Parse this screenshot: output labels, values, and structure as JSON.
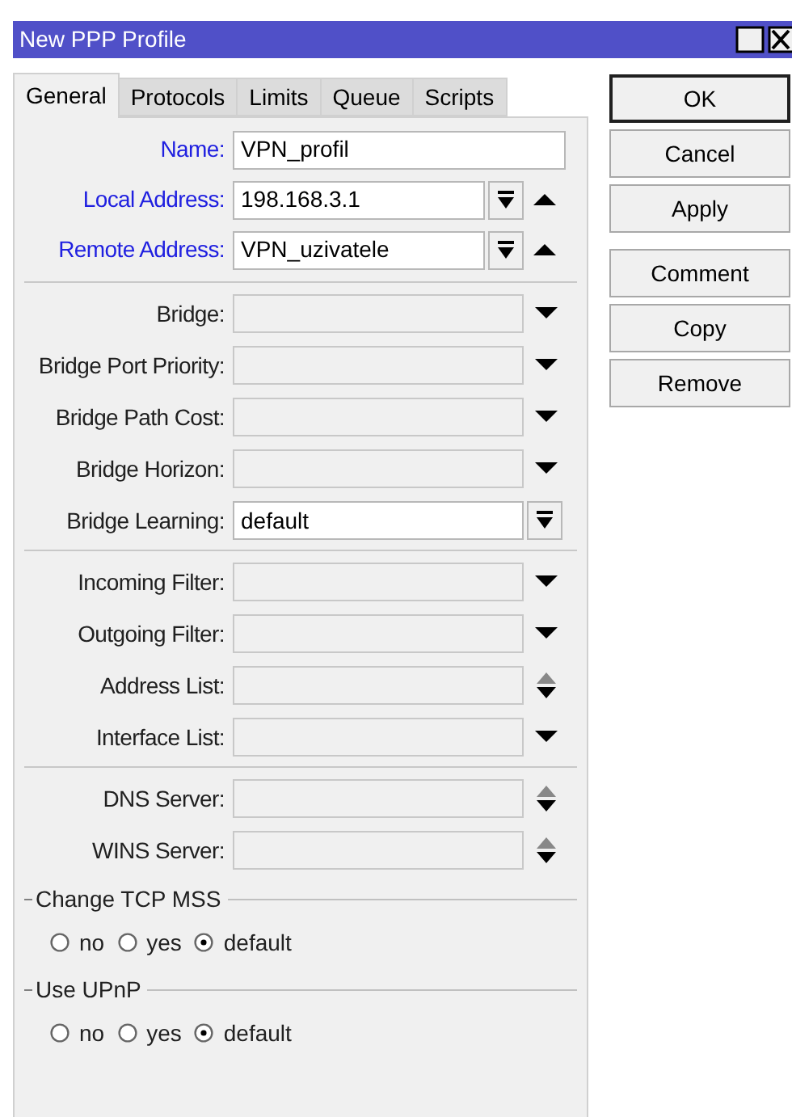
{
  "window": {
    "title": "New PPP Profile"
  },
  "tabs": [
    {
      "label": "General",
      "selected": true
    },
    {
      "label": "Protocols",
      "selected": false
    },
    {
      "label": "Limits",
      "selected": false
    },
    {
      "label": "Queue",
      "selected": false
    },
    {
      "label": "Scripts",
      "selected": false
    }
  ],
  "sections": [
    [
      {
        "label": "Name:",
        "kind": "text",
        "value": "VPN_profil",
        "emphasized": true,
        "disabled": false
      },
      {
        "label": "Local Address:",
        "kind": "combo",
        "value": "198.168.3.1",
        "emphasized": true,
        "disabled": false
      },
      {
        "label": "Remote Address:",
        "kind": "combo",
        "value": "VPN_uzivatele",
        "emphasized": true,
        "disabled": false
      }
    ],
    [
      {
        "label": "Bridge:",
        "kind": "dropdown",
        "emphasized": false,
        "disabled": true
      },
      {
        "label": "Bridge Port Priority:",
        "kind": "dropdown",
        "emphasized": false,
        "disabled": true
      },
      {
        "label": "Bridge Path Cost:",
        "kind": "dropdown",
        "emphasized": false,
        "disabled": true
      },
      {
        "label": "Bridge Horizon:",
        "kind": "dropdown",
        "emphasized": false,
        "disabled": true
      },
      {
        "label": "Bridge Learning:",
        "kind": "select",
        "value": "default",
        "emphasized": false,
        "disabled": false
      }
    ],
    [
      {
        "label": "Incoming Filter:",
        "kind": "dropdown",
        "emphasized": false,
        "disabled": true
      },
      {
        "label": "Outgoing Filter:",
        "kind": "dropdown",
        "emphasized": false,
        "disabled": true
      },
      {
        "label": "Address List:",
        "kind": "spinner",
        "emphasized": false,
        "disabled": true
      },
      {
        "label": "Interface List:",
        "kind": "dropdown",
        "emphasized": false,
        "disabled": true
      }
    ],
    [
      {
        "label": "DNS Server:",
        "kind": "spinner",
        "emphasized": false,
        "disabled": true
      },
      {
        "label": "WINS Server:",
        "kind": "spinner",
        "emphasized": false,
        "disabled": true
      }
    ]
  ],
  "radio_groups": [
    {
      "title": "Change TCP MSS",
      "options": [
        {
          "label": "no",
          "selected": false
        },
        {
          "label": "yes",
          "selected": false
        },
        {
          "label": "default",
          "selected": true
        }
      ]
    },
    {
      "title": "Use UPnP",
      "options": [
        {
          "label": "no",
          "selected": false
        },
        {
          "label": "yes",
          "selected": false
        },
        {
          "label": "default",
          "selected": true
        }
      ]
    }
  ],
  "buttons": [
    {
      "label": "OK",
      "default": true
    },
    {
      "label": "Cancel",
      "default": false
    },
    {
      "label": "Apply",
      "default": false
    },
    {
      "label": "Comment",
      "default": false
    },
    {
      "label": "Copy",
      "default": false
    },
    {
      "label": "Remove",
      "default": false
    }
  ]
}
